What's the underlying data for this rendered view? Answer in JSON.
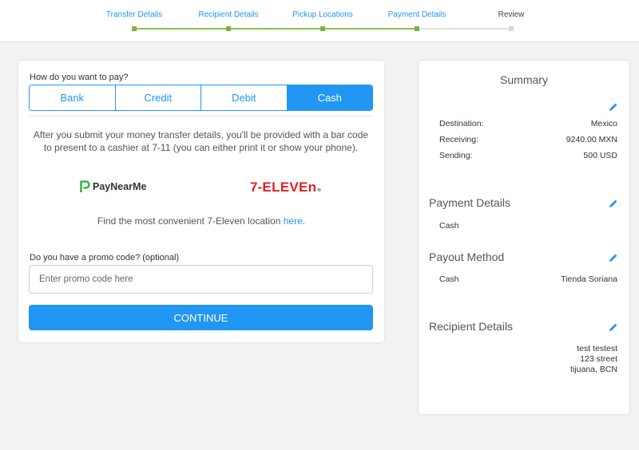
{
  "steps": [
    {
      "label": "Transfer Details",
      "state": "done"
    },
    {
      "label": "Recipient Details",
      "state": "done"
    },
    {
      "label": "Pickup Locations",
      "state": "done"
    },
    {
      "label": "Payment Details",
      "state": "done"
    },
    {
      "label": "Review",
      "state": "current"
    }
  ],
  "payment": {
    "question": "How do you want to pay?",
    "options": [
      "Bank",
      "Credit",
      "Debit",
      "Cash"
    ],
    "selected": "Cash",
    "info": "After you submit your money transfer details, you'll be provided with a bar code to present to a cashier at 7-11 (you can either print it or show your phone).",
    "partner_logos": {
      "paynearme": "PayNearMe",
      "seven_num": "7",
      "seven_text": "-ELEVEn",
      "seven_reg": "®"
    },
    "find_text": "Find the most convenient 7-Eleven location ",
    "find_link": "here",
    "find_suffix": "."
  },
  "promo": {
    "label": "Do you have a promo code? (optional)",
    "placeholder": "Enter promo code here"
  },
  "continue_label": "CONTINUE",
  "summary": {
    "title": "Summary",
    "rows": [
      {
        "label": "Destination:",
        "value": "Mexico"
      },
      {
        "label": "Receiving:",
        "value": "9240.00 MXN"
      },
      {
        "label": "Sending:",
        "value": "500 USD"
      }
    ],
    "payment_details": {
      "title": "Payment Details",
      "value": "Cash"
    },
    "payout_method": {
      "title": "Payout Method",
      "label": "Cash",
      "value": "Tienda Soriana"
    },
    "recipient_details": {
      "title": "Recipient Details",
      "lines": [
        "test testest",
        "123 street",
        "tijuana, BCN"
      ]
    }
  },
  "colors": {
    "accent": "#2196f3",
    "progress": "#8bc34a",
    "seven_eleven_red": "#e31e24",
    "paynearme_green": "#3cb44b"
  },
  "icons": {
    "edit": "pencil-icon",
    "paynearme": "paynearme-logo-icon"
  }
}
